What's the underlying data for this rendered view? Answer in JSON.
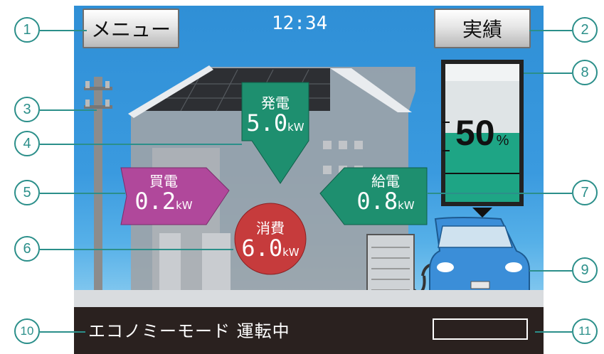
{
  "header": {
    "menu_label": "メニュー",
    "time": "12:34",
    "results_label": "実績"
  },
  "flows": {
    "generation": {
      "title": "発電",
      "value": "5.0",
      "unit": "kW"
    },
    "purchase": {
      "title": "買電",
      "value": "0.2",
      "unit": "kW"
    },
    "consumption": {
      "title": "消費",
      "value": "6.0",
      "unit": "kW"
    },
    "supply": {
      "title": "給電",
      "value": "0.8",
      "unit": "kW"
    }
  },
  "battery": {
    "percent": "50",
    "unit": "%",
    "level": 0.5
  },
  "footer": {
    "mode": "エコノミーモード 運転中"
  },
  "callouts": [
    "1",
    "2",
    "3",
    "4",
    "5",
    "6",
    "7",
    "8",
    "9",
    "10",
    "11"
  ],
  "colors": {
    "sky": "#3a9adf",
    "generation": "#1e8f6f",
    "purchase": "#b0489b",
    "consumption": "#c63b3c",
    "supply": "#1e8f6f",
    "callout": "#2b8f8a"
  }
}
